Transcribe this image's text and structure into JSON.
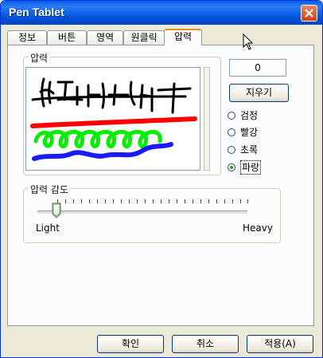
{
  "window": {
    "title": "Pen Tablet"
  },
  "tabs": [
    {
      "label": "정보"
    },
    {
      "label": "버튼"
    },
    {
      "label": "영역"
    },
    {
      "label": "원클릭"
    },
    {
      "label": "압력",
      "active": true
    }
  ],
  "pressure_group": {
    "legend": "압력",
    "value": "0",
    "clear_label": "지우기",
    "colors": [
      {
        "label": "검정",
        "hex": "#000000"
      },
      {
        "label": "빨강",
        "hex": "#ff0000"
      },
      {
        "label": "초록",
        "hex": "#00ff00"
      },
      {
        "label": "파랑",
        "hex": "#0000ff",
        "selected": true
      }
    ],
    "drawing_icons": [
      "black-handwriting",
      "red-line",
      "green-loops",
      "blue-wave"
    ]
  },
  "sensitivity_group": {
    "legend": "압력 감도",
    "min_label": "Light",
    "max_label": "Heavy",
    "level": 0
  },
  "footer": {
    "ok_label": "확인",
    "cancel_label": "취소",
    "apply_label": "적용(A)"
  },
  "theme": {
    "title_bar": "#0054e3",
    "close_button": "#d64d28",
    "tab_highlight": "#e68b2c"
  }
}
